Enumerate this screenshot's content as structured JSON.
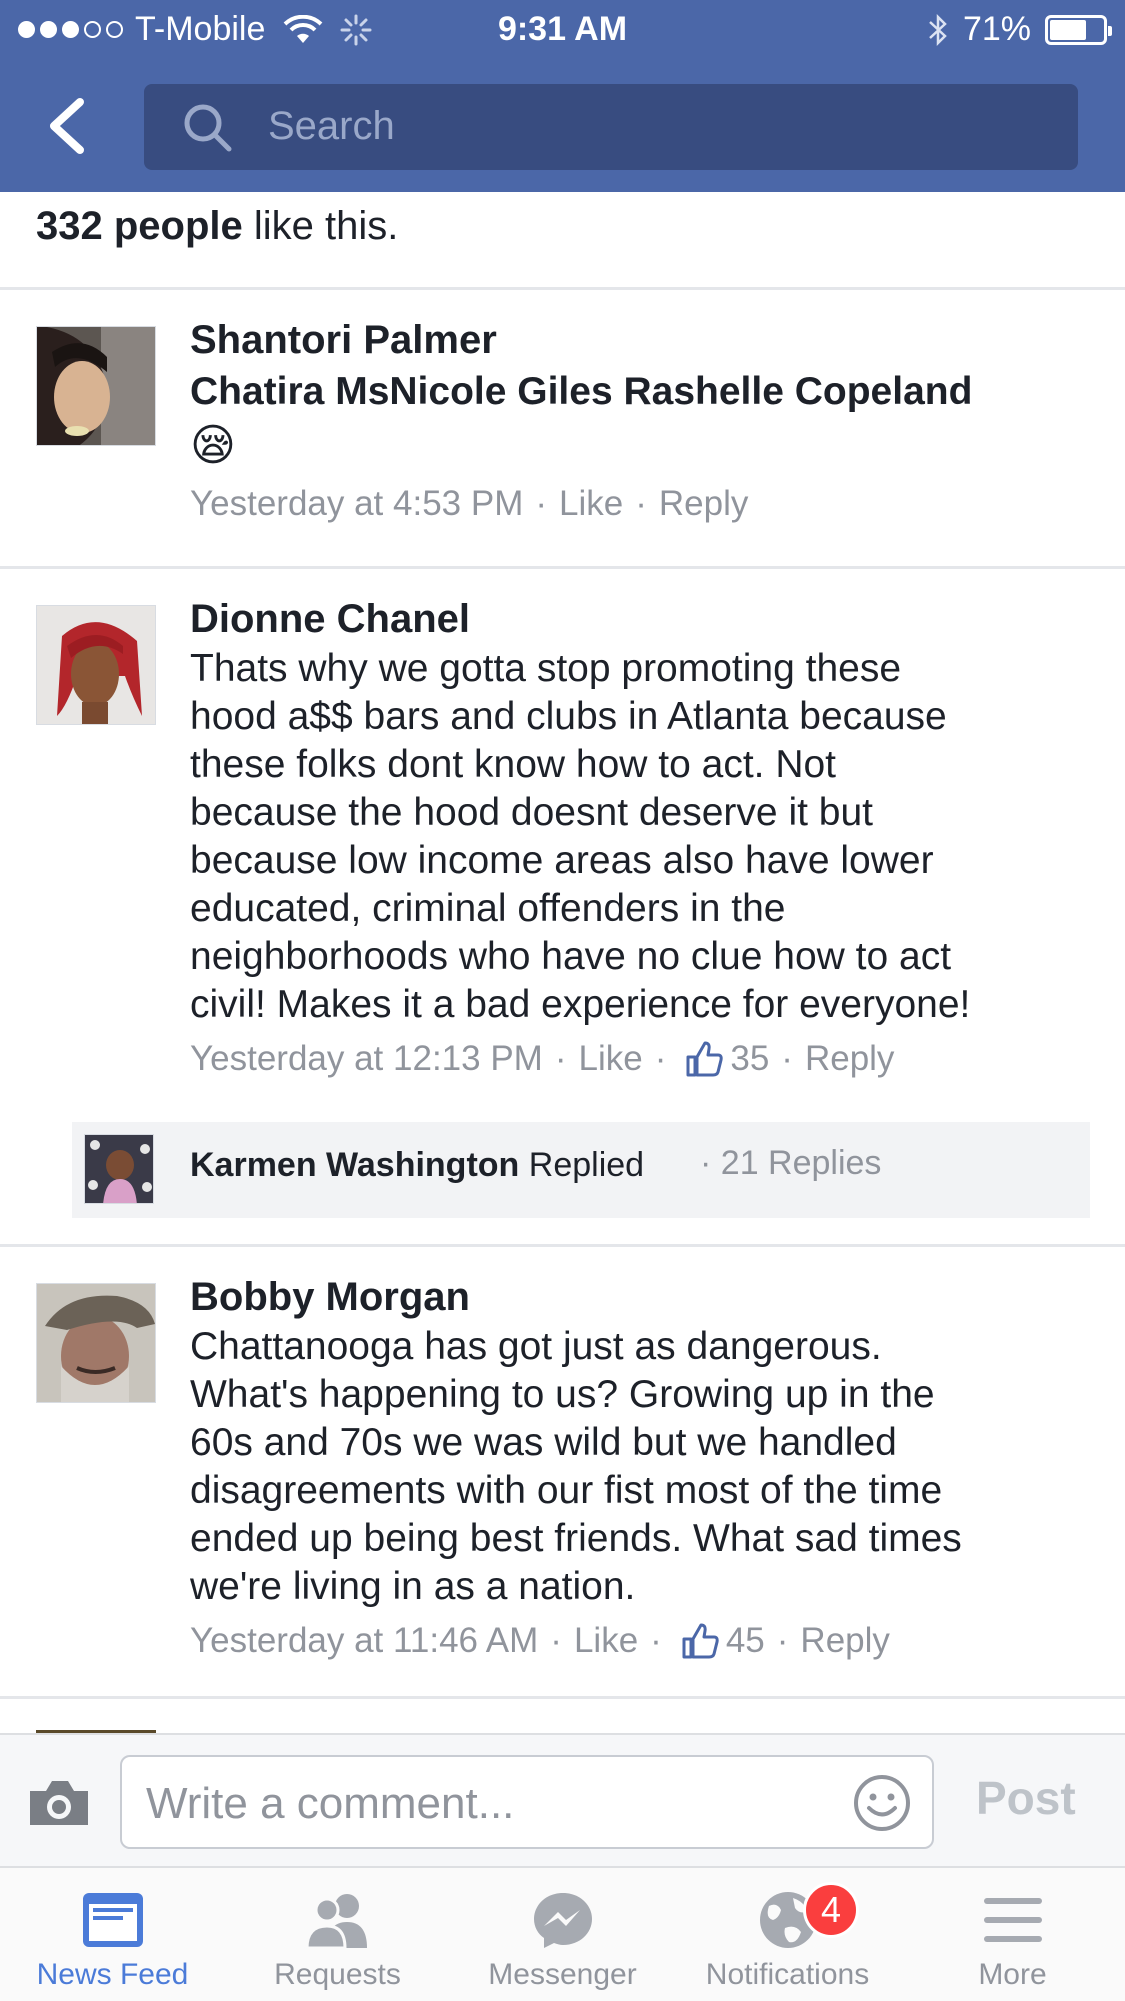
{
  "status_bar": {
    "carrier": "T-Mobile",
    "time": "9:31 AM",
    "battery": "71%",
    "battery_level": 0.71,
    "signal_bars_filled": 3,
    "signal_bars_total": 5
  },
  "header": {
    "search_placeholder": "Search"
  },
  "likes": {
    "count_text": "332 people",
    "suffix": " like this."
  },
  "comments": [
    {
      "author": "Shantori Palmer",
      "text": "Chatira MsNicole Giles Rashelle Copeland",
      "emoji": "😪",
      "time": "Yesterday at 4:53 PM",
      "like_label": "Like",
      "reply_label": "Reply"
    },
    {
      "author": "Dionne Chanel",
      "text_lines": [
        "Thats why we gotta stop promoting these",
        "hood a$$ bars and clubs in Atlanta because",
        "these folks dont know how to act. Not",
        "because the hood doesnt deserve it but",
        "because low income areas also have lower",
        "educated, criminal offenders in the",
        "neighborhoods who have no clue how to act",
        "civil! Makes it a bad experience for everyone!"
      ],
      "time": "Yesterday at 12:13 PM",
      "like_label": "Like",
      "like_count": "35",
      "reply_label": "Reply",
      "reply_preview": {
        "name": "Karmen Washington",
        "action": "Replied",
        "count": "21 Replies"
      }
    },
    {
      "author": "Bobby Morgan",
      "text_lines": [
        "Chattanooga has got just as dangerous.",
        "What's happening to us? Growing up in the",
        "60s and 70s we was wild but we handled",
        "disagreements with our fist most of the time",
        "ended up being best friends. What sad times",
        "we're living in as a nation."
      ],
      "time": "Yesterday at 11:46 AM",
      "like_label": "Like",
      "like_count": "45",
      "reply_label": "Reply"
    }
  ],
  "composer": {
    "placeholder": "Write a comment...",
    "post_label": "Post"
  },
  "tabs": [
    {
      "label": "News Feed",
      "icon": "news-feed-icon",
      "active": true
    },
    {
      "label": "Requests",
      "icon": "friend-requests-icon",
      "active": false
    },
    {
      "label": "Messenger",
      "icon": "messenger-icon",
      "active": false
    },
    {
      "label": "Notifications",
      "icon": "globe-icon",
      "active": false,
      "badge": "4"
    },
    {
      "label": "More",
      "icon": "menu-icon",
      "active": false
    }
  ],
  "colors": {
    "brand": "#4b67a8",
    "search_bg": "#384c80",
    "meta_gray": "#90949c",
    "active_tab": "#4b7bd8",
    "badge_red": "#fa3e3e"
  }
}
